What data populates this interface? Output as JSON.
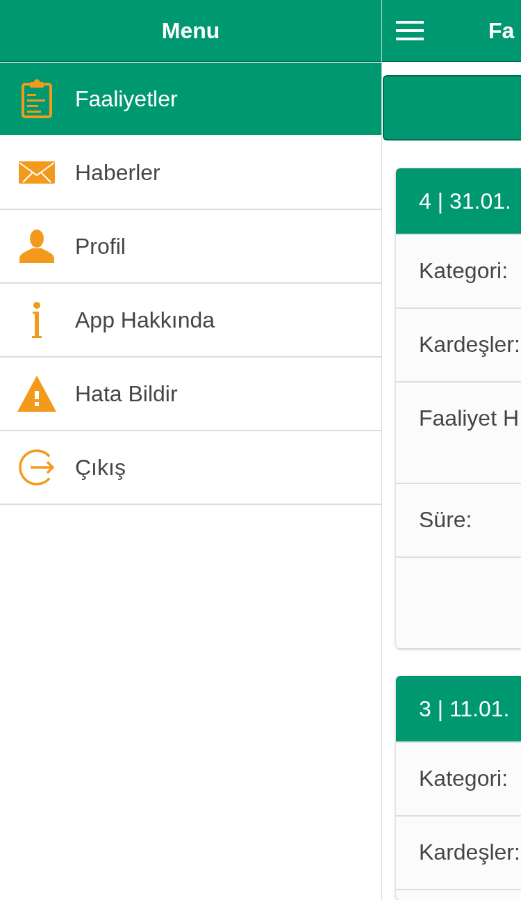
{
  "menu": {
    "title": "Menu",
    "items": [
      {
        "label": "Faaliyetler",
        "selected": true
      },
      {
        "label": "Haberler",
        "selected": false
      },
      {
        "label": "Profil",
        "selected": false
      },
      {
        "label": "App Hakkında",
        "selected": false
      },
      {
        "label": "Hata Bildir",
        "selected": false
      },
      {
        "label": "Çıkış",
        "selected": false
      }
    ]
  },
  "main": {
    "title": "Fa",
    "cards": [
      {
        "title": "4 | 31.01.",
        "fields": [
          "Kategori:",
          "Kardeşler:",
          "Faaliyet H",
          "Süre:"
        ]
      },
      {
        "title": "3 | 11.01.",
        "fields": [
          "Kategori:",
          "Kardeşler:"
        ]
      }
    ]
  }
}
